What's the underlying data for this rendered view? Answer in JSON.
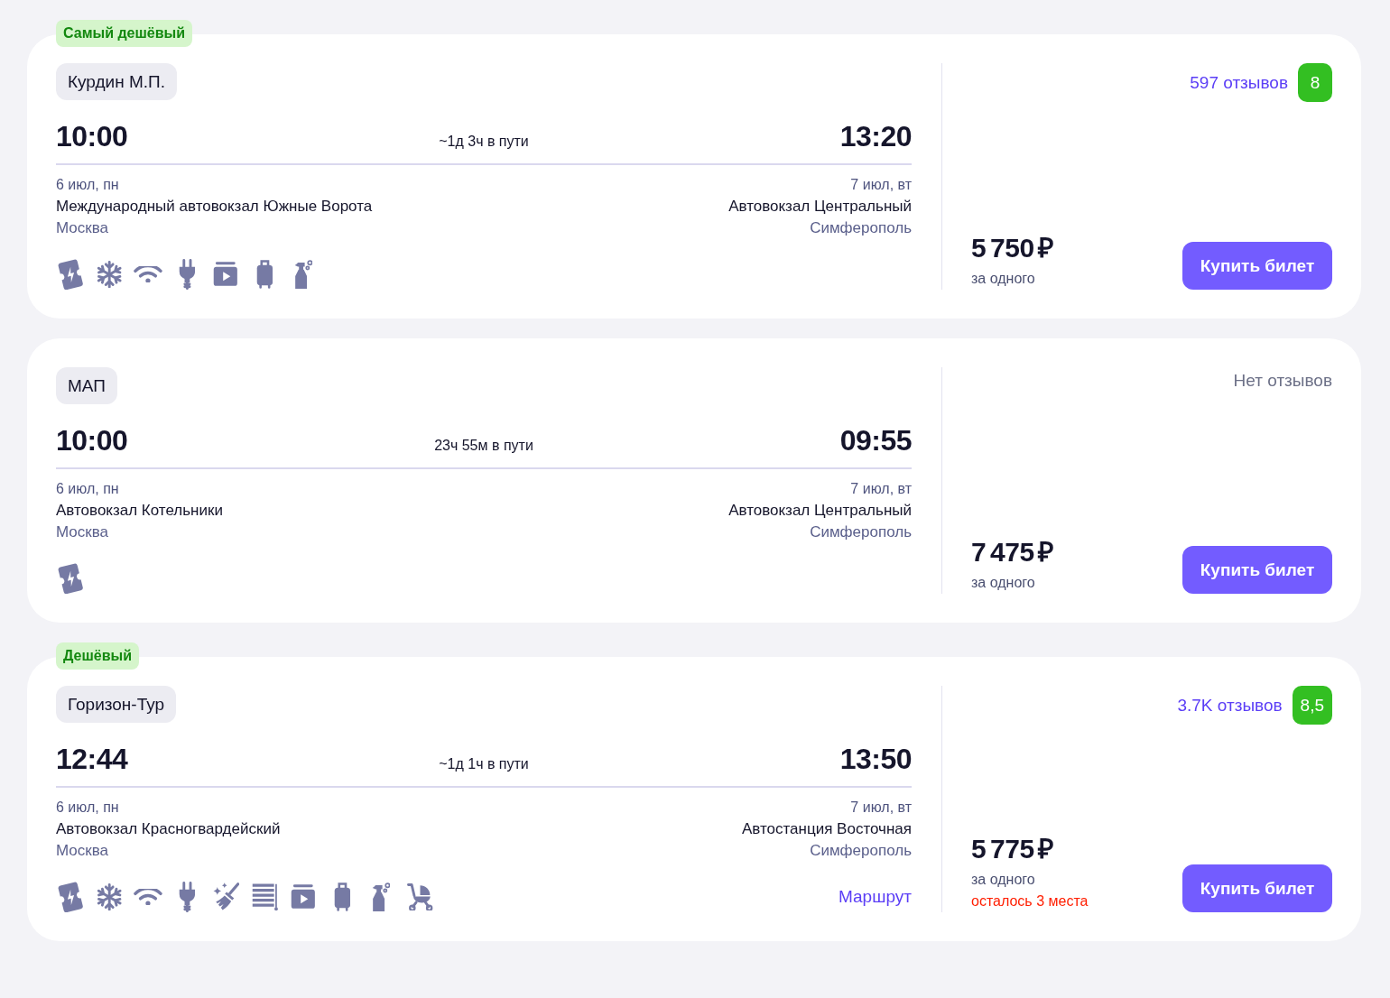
{
  "trips": [
    {
      "badge": "Самый дешёвый",
      "carrier": "Курдин М.П.",
      "departure": {
        "time": "10:00",
        "date": "6 июл, пн",
        "station": "Международный автовокзал Южные Ворота",
        "city": "Москва"
      },
      "duration": "~1д 3ч в пути",
      "arrival": {
        "time": "13:20",
        "date": "7 июл, вт",
        "station": "Автовокзал Центральный",
        "city": "Симферополь"
      },
      "amenities": [
        {
          "kind": "ticket"
        },
        {
          "kind": "snowflake"
        },
        {
          "kind": "wifi"
        },
        {
          "kind": "plug"
        },
        {
          "kind": "video"
        },
        {
          "kind": "suitcase"
        },
        {
          "kind": "spray"
        }
      ],
      "reviews": {
        "label": "597 отзывов",
        "rating": "8"
      },
      "price": "5 750 ₽",
      "price_note": "за одного",
      "buy_button": "Купить билет"
    },
    {
      "carrier": "МАП",
      "departure": {
        "time": "10:00",
        "date": "6 июл, пн",
        "station": "Автовокзал Котельники",
        "city": "Москва"
      },
      "duration": "23ч 55м в пути",
      "arrival": {
        "time": "09:55",
        "date": "7 июл, вт",
        "station": "Автовокзал Центральный",
        "city": "Симферополь"
      },
      "amenities": [
        {
          "kind": "ticket"
        }
      ],
      "reviews": {
        "label": "Нет отзывов"
      },
      "price": "7 475 ₽",
      "price_note": "за одного",
      "buy_button": "Купить билет"
    },
    {
      "badge": "Дешёвый",
      "carrier": "Горизон-Тур",
      "departure": {
        "time": "12:44",
        "date": "6 июл, пн",
        "station": "Автовокзал Красногвардейский",
        "city": "Москва"
      },
      "duration": "~1д 1ч в пути",
      "arrival": {
        "time": "13:50",
        "date": "7 июл, вт",
        "station": "Автостанция Восточная",
        "city": "Симферополь"
      },
      "amenities": [
        {
          "kind": "ticket"
        },
        {
          "kind": "snowflake"
        },
        {
          "kind": "wifi"
        },
        {
          "kind": "plug"
        },
        {
          "kind": "broom"
        },
        {
          "kind": "blinds"
        },
        {
          "kind": "video"
        },
        {
          "kind": "suitcase"
        },
        {
          "kind": "spray"
        },
        {
          "kind": "stroller"
        }
      ],
      "route_link": "Маршрут",
      "reviews": {
        "label": "3.7K отзывов",
        "rating": "8,5"
      },
      "price": "5 775 ₽",
      "price_note": "за одного",
      "seats_left": "осталось 3 места",
      "buy_button": "Купить билет"
    }
  ]
}
